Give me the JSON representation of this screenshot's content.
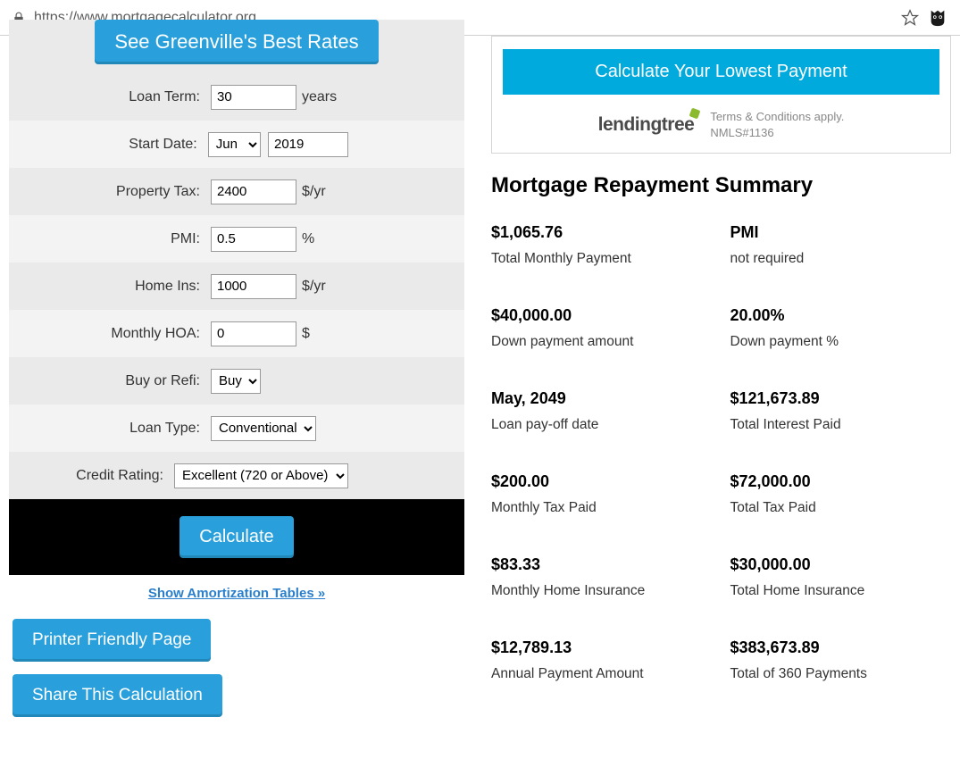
{
  "url": "https://www.mortgagecalculator.org",
  "rates_button": "See Greenville's Best Rates",
  "form": {
    "loan_term": {
      "label": "Loan Term:",
      "value": "30",
      "unit": "years"
    },
    "start_date": {
      "label": "Start Date:",
      "month": "Jun",
      "year": "2019"
    },
    "property_tax": {
      "label": "Property Tax:",
      "value": "2400",
      "unit": "$/yr"
    },
    "pmi": {
      "label": "PMI:",
      "value": "0.5",
      "unit": "%"
    },
    "home_ins": {
      "label": "Home Ins:",
      "value": "1000",
      "unit": "$/yr"
    },
    "hoa": {
      "label": "Monthly HOA:",
      "value": "0",
      "unit": "$"
    },
    "buy_refi": {
      "label": "Buy or Refi:",
      "value": "Buy"
    },
    "loan_type": {
      "label": "Loan Type:",
      "value": "Conventional"
    },
    "credit_rating": {
      "label": "Credit Rating:",
      "value": "Excellent (720 or Above)"
    }
  },
  "calculate_label": "Calculate",
  "amort_link": "Show Amortization Tables »",
  "printer_btn": "Printer Friendly Page",
  "share_btn": "Share This Calculation",
  "ad": {
    "button": "Calculate Your Lowest Payment",
    "logo": "lendingtree",
    "terms1": "Terms & Conditions apply.",
    "terms2": "NMLS#1136"
  },
  "summary": {
    "title": "Mortgage Repayment Summary",
    "items": [
      {
        "val": "$1,065.76",
        "lbl": "Total Monthly Payment"
      },
      {
        "val": "PMI",
        "lbl": "not required"
      },
      {
        "val": "$40,000.00",
        "lbl": "Down payment amount"
      },
      {
        "val": "20.00%",
        "lbl": "Down payment %"
      },
      {
        "val": "May, 2049",
        "lbl": "Loan pay-off date"
      },
      {
        "val": "$121,673.89",
        "lbl": "Total Interest Paid"
      },
      {
        "val": "$200.00",
        "lbl": "Monthly Tax Paid"
      },
      {
        "val": "$72,000.00",
        "lbl": "Total Tax Paid"
      },
      {
        "val": "$83.33",
        "lbl": "Monthly Home Insurance"
      },
      {
        "val": "$30,000.00",
        "lbl": "Total Home Insurance"
      },
      {
        "val": "$12,789.13",
        "lbl": "Annual Payment Amount"
      },
      {
        "val": "$383,673.89",
        "lbl": "Total of 360 Payments"
      }
    ]
  }
}
